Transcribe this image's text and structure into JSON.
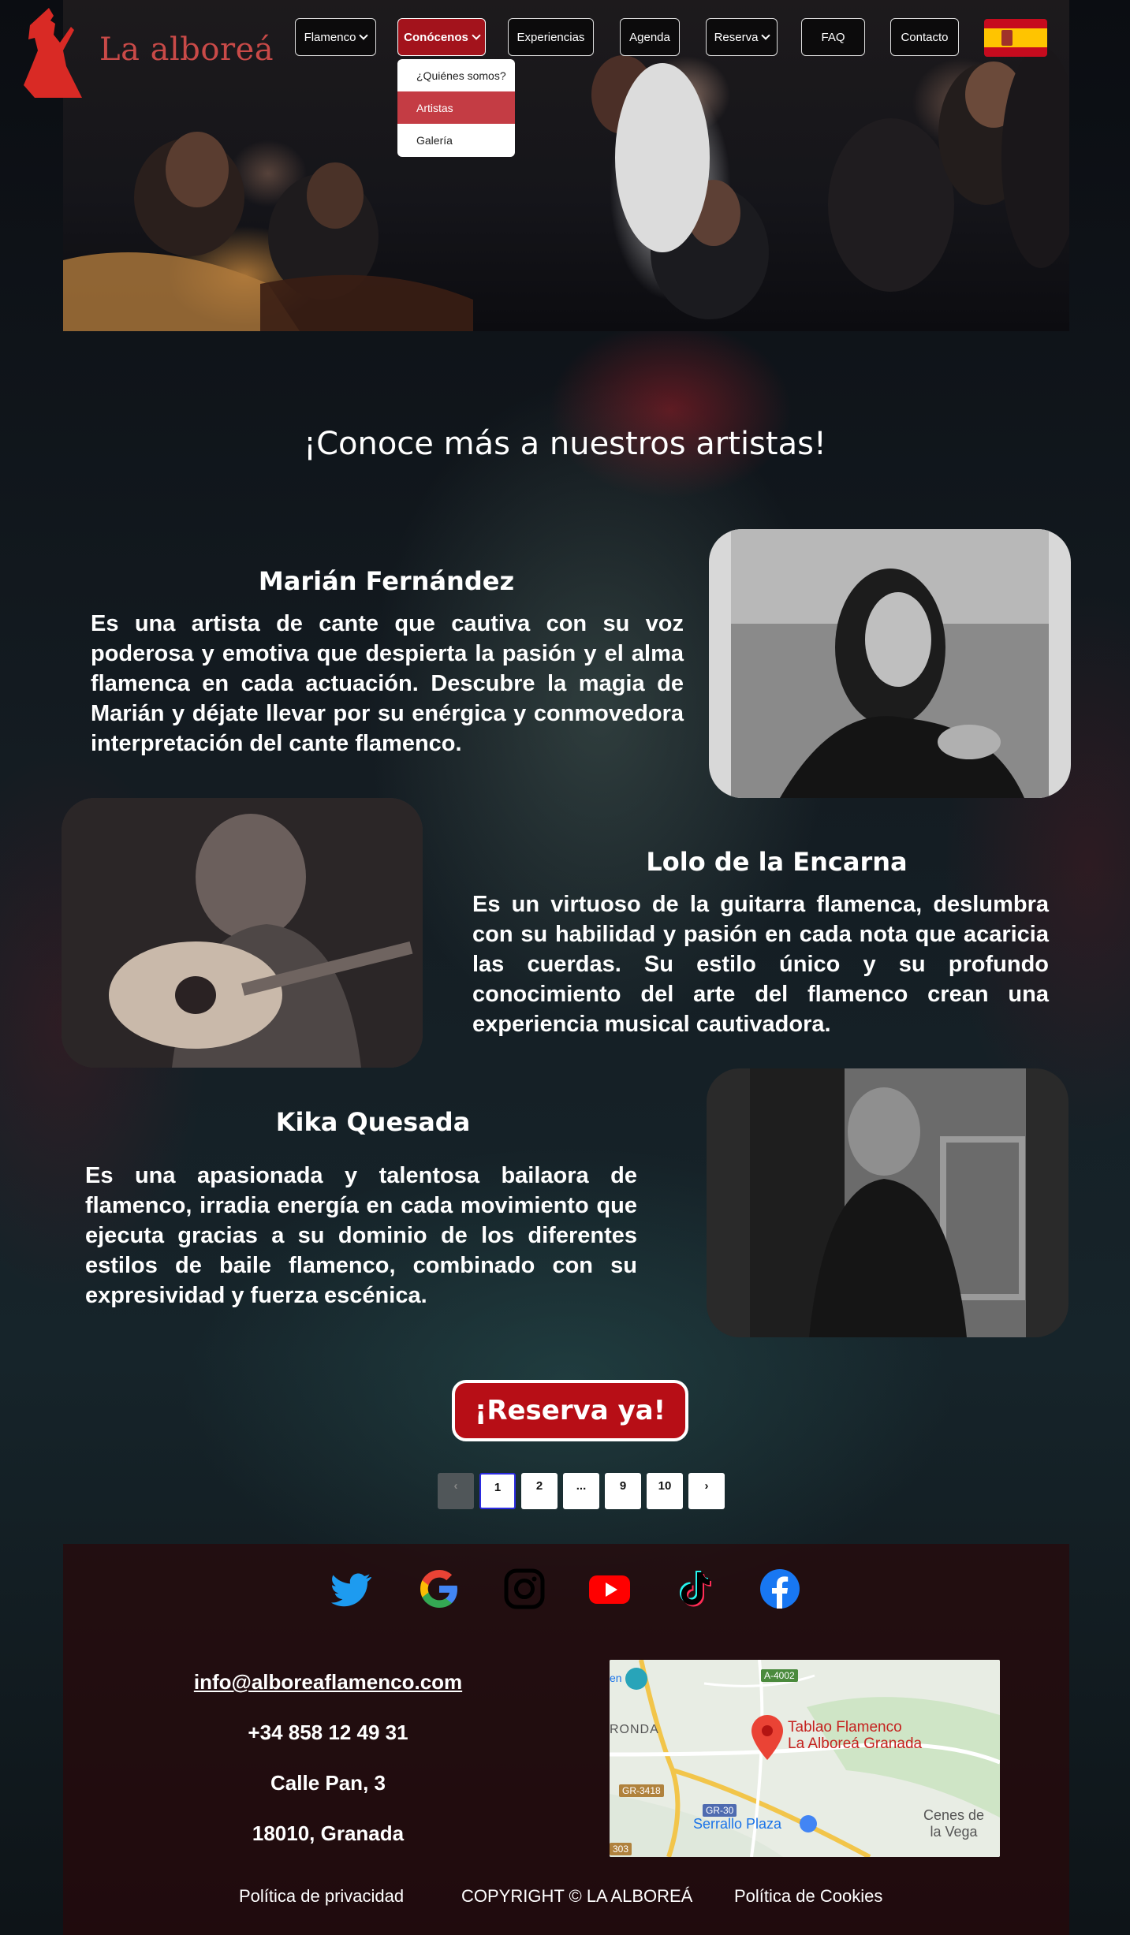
{
  "brand": {
    "name": "La alboreá"
  },
  "nav": {
    "items": [
      {
        "label": "Flamenco",
        "dropdown": true
      },
      {
        "label": "Conócenos",
        "dropdown": true,
        "active": true
      },
      {
        "label": "Experiencias",
        "dropdown": false
      },
      {
        "label": "Agenda",
        "dropdown": false
      },
      {
        "label": "Reserva",
        "dropdown": true
      },
      {
        "label": "FAQ",
        "dropdown": false
      },
      {
        "label": "Contacto",
        "dropdown": false
      }
    ],
    "dropdown_items": [
      "¿Quiénes somos?",
      "Artistas",
      "Galería"
    ],
    "dropdown_selected": "Artistas",
    "language_flag": "spain-flag-icon"
  },
  "main": {
    "title": "¡Conoce más a nuestros artistas!",
    "artists": [
      {
        "name": "Marián Fernández",
        "bio": "Es una artista de cante que cautiva con su voz poderosa y emotiva que despierta la pasión y el alma flamenca en cada actuación. Descubre la magia de Marián y déjate llevar por su enérgica y conmovedora interpretación del cante flamenco."
      },
      {
        "name": "Lolo de la Encarna",
        "bio": "Es un virtuoso de la guitarra flamenca, deslumbra con su habilidad y pasión en cada nota que acaricia las cuerdas. Su estilo único y su profundo conocimiento del arte del flamenco crean una experiencia musical cautivadora."
      },
      {
        "name": "Kika Quesada",
        "bio": "Es una apasionada y talentosa bailaora de flamenco, irradia energía en cada movimiento que ejecuta gracias a su dominio de los diferentes estilos de baile flamenco, combinado con su expresividad y fuerza escénica."
      }
    ],
    "cta_label": "¡Reserva ya!",
    "pagination": {
      "prev": "‹",
      "pages": [
        "1",
        "2",
        "...",
        "9",
        "10"
      ],
      "current": "1",
      "next": "›"
    }
  },
  "footer": {
    "social": [
      "twitter-icon",
      "google-icon",
      "instagram-icon",
      "youtube-icon",
      "tiktok-icon",
      "facebook-icon"
    ],
    "email": "info@alboreaflamenco.com",
    "phone": "+34 858 12 49 31",
    "street": "Calle Pan, 3",
    "city": "18010, Granada",
    "map": {
      "place_line1": "Tablao Flamenco",
      "place_line2": "La Alboreá Granada",
      "road1": "A-4002",
      "road2": "GR-3418",
      "road3": "GR-30",
      "road4": "303",
      "area1": "RONDA",
      "area2": "Serrallo Plaza",
      "area3_line1": "Cenes de",
      "area3_line2": "la Vega",
      "area4": "en"
    },
    "privacy": "Política de privacidad",
    "copyright": "COPYRIGHT © LA ALBOREÁ",
    "cookies": "Política de Cookies"
  },
  "colors": {
    "accent": "#b70e16",
    "brand": "#c94a48",
    "dropdown_selected": "#c43c44"
  }
}
